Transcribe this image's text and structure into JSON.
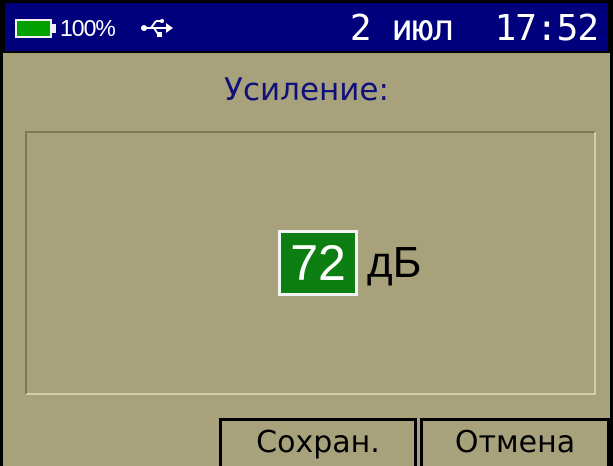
{
  "status_bar": {
    "battery_percent": "100%",
    "battery_level": 1.0,
    "usb_icon": "usb-icon",
    "date": "2 июл",
    "time": "17:52"
  },
  "title": "Усиление:",
  "value": "72",
  "unit": "дБ",
  "buttons": {
    "save_label": "Сохран.",
    "cancel_label": "Отмена"
  },
  "colors": {
    "screen_background": "#a7a27c",
    "status_bar": "#00007c",
    "battery_fill": "#00a000",
    "value_highlight": "#0d7f12",
    "title_text": "#10107a"
  }
}
